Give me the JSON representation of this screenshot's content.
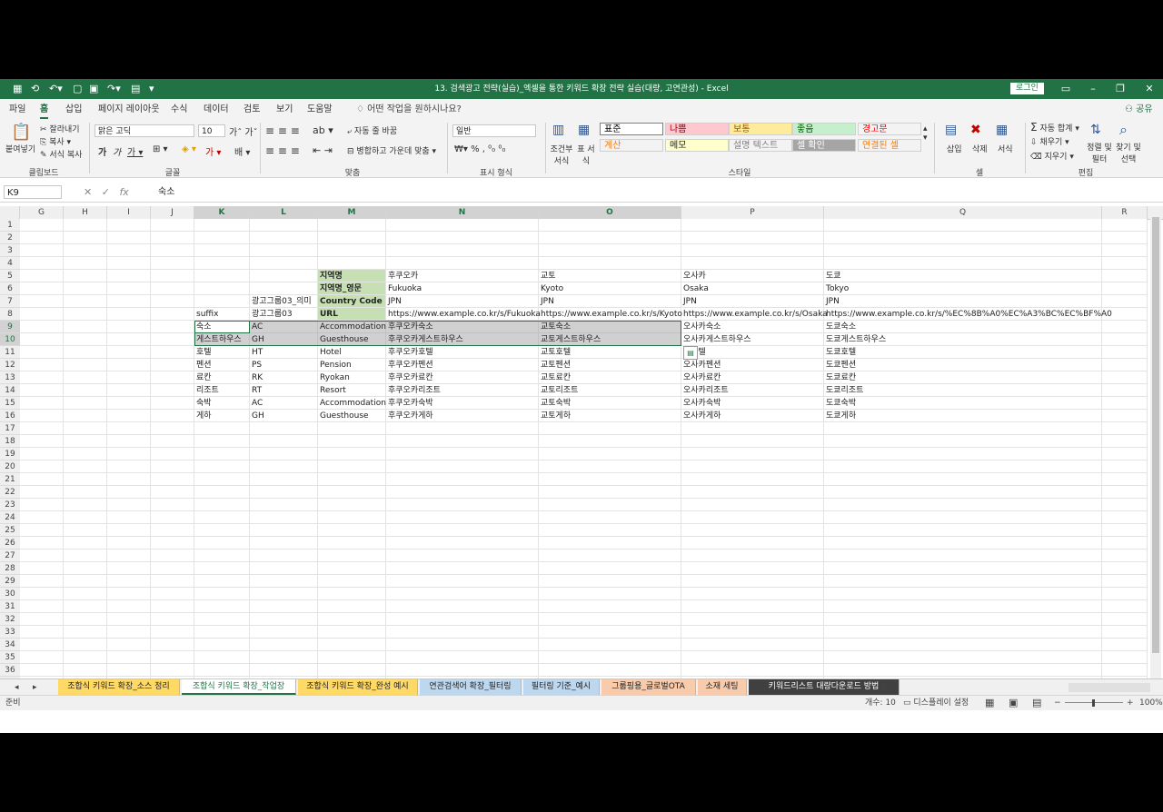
{
  "window": {
    "title": "13. 검색광고 전략(실습)_엑셀을 통한 키워드 확장 전략 실습(대량, 고연관성)  -  Excel",
    "login_label": "로그인"
  },
  "ribbon_tabs": [
    "파일",
    "홈",
    "삽입",
    "페이지 레이아웃",
    "수식",
    "데이터",
    "검토",
    "보기",
    "도움말"
  ],
  "active_tab": "홈",
  "tell_me": "어떤 작업을 원하시나요?",
  "share_label": "공유",
  "ribbon": {
    "clipboard": {
      "paste": "붙여넣기",
      "cut": "잘라내기",
      "copy": "복사",
      "format_painter": "서식 복사",
      "label": "클립보드"
    },
    "font": {
      "name": "맑은 고딕",
      "size": "10",
      "label": "글꼴"
    },
    "alignment": {
      "wrap": "자동 줄 바꿈",
      "merge": "병합하고 가운데 맞춤",
      "label": "맞춤"
    },
    "number": {
      "format": "일반",
      "label": "표시 형식"
    },
    "styles": {
      "conditional": "조건부 서식",
      "table": "표 서식",
      "items": [
        {
          "label": "표준",
          "bg": "#ffffff",
          "color": "#000000"
        },
        {
          "label": "나쁨",
          "bg": "#ffc7ce",
          "color": "#9c0006"
        },
        {
          "label": "보통",
          "bg": "#ffeb9c",
          "color": "#9c5700"
        },
        {
          "label": "좋음",
          "bg": "#c6efce",
          "color": "#006100"
        },
        {
          "label": "경고문",
          "bg": "#f3f3f3",
          "color": "#ff0000"
        },
        {
          "label": "계산",
          "bg": "#f2f2f2",
          "color": "#fa7d00"
        },
        {
          "label": "메모",
          "bg": "#ffffcc",
          "color": "#222222"
        },
        {
          "label": "설명 텍스트",
          "bg": "#f3f3f3",
          "color": "#7f7f7f"
        },
        {
          "label": "셀 확인",
          "bg": "#a5a5a5",
          "color": "#ffffff"
        },
        {
          "label": "연결된 셀",
          "bg": "#f3f3f3",
          "color": "#fa7d00"
        }
      ],
      "label": "스타일"
    },
    "cells": {
      "insert": "삽입",
      "delete": "삭제",
      "format": "서식",
      "label": "셀"
    },
    "editing": {
      "autosum": "자동 합계",
      "fill": "채우기",
      "clear": "지우기",
      "sort": "정렬 및 필터",
      "find": "찾기 및 선택",
      "label": "편집"
    }
  },
  "formula_bar": {
    "name_box": "K9",
    "formula": "숙소"
  },
  "columns": [
    "G",
    "H",
    "I",
    "J",
    "K",
    "L",
    "M",
    "N",
    "O",
    "P",
    "Q",
    "R"
  ],
  "rows": [
    "1",
    "2",
    "3",
    "4",
    "5",
    "6",
    "7",
    "8",
    "9",
    "10",
    "11",
    "12",
    "13",
    "14",
    "15",
    "16",
    "17",
    "18",
    "19",
    "20",
    "21",
    "22",
    "23",
    "24",
    "25",
    "26",
    "27",
    "28",
    "29",
    "30",
    "31",
    "32",
    "33",
    "34",
    "35",
    "36"
  ],
  "grid": {
    "r5": {
      "M": "지역명",
      "N": "후쿠오카",
      "O": "교토",
      "P": "오사카",
      "Q": "도쿄"
    },
    "r6": {
      "M": "지역명_영문",
      "N": "Fukuoka",
      "O": "Kyoto",
      "P": "Osaka",
      "Q": "Tokyo"
    },
    "r7": {
      "L": "광고그룹03_의미",
      "M": "Country Code",
      "N": "JPN",
      "O": "JPN",
      "P": "JPN",
      "Q": "JPN"
    },
    "r8": {
      "K": "suffix",
      "L": "광고그룹03",
      "M": "URL",
      "N": "https://www.example.co.kr/s/Fukuoka",
      "O": "https://www.example.co.kr/s/Kyoto",
      "P": "https://www.example.co.kr/s/Osaka",
      "Q": "https://www.example.co.kr/s/%EC%8B%A0%EC%A3%BC%EC%BF%A0"
    },
    "r9": {
      "K": "숙소",
      "L": "AC",
      "M": "Accommodation",
      "N": "후쿠오카숙소",
      "O": "교토숙소",
      "P": "오사카숙소",
      "Q": "도쿄숙소"
    },
    "r10": {
      "K": "게스트하우스",
      "L": "GH",
      "M": "Guesthouse",
      "N": "후쿠오카게스트하우스",
      "O": "교토게스트하우스",
      "P": "오사카게스트하우스",
      "Q": "도쿄게스트하우스"
    },
    "r11": {
      "K": "호텔",
      "L": "HT",
      "M": "Hotel",
      "N": "후쿠오카호텔",
      "O": "교토호텔",
      "P": "카호텔",
      "Q": "도쿄호텔"
    },
    "r12": {
      "K": "펜션",
      "L": "PS",
      "M": "Pension",
      "N": "후쿠오카펜션",
      "O": "교토펜션",
      "P": "오사카펜션",
      "Q": "도쿄펜션"
    },
    "r13": {
      "K": "료칸",
      "L": "RK",
      "M": "Ryokan",
      "N": "후쿠오카료칸",
      "O": "교토료칸",
      "P": "오사카료칸",
      "Q": "도쿄료칸"
    },
    "r14": {
      "K": "리조트",
      "L": "RT",
      "M": "Resort",
      "N": "후쿠오카리조트",
      "O": "교토리조트",
      "P": "오사카리조트",
      "Q": "도쿄리조트"
    },
    "r15": {
      "K": "숙박",
      "L": "AC",
      "M": "Accommodation",
      "N": "후쿠오카숙박",
      "O": "교토숙박",
      "P": "오사카숙박",
      "Q": "도쿄숙박"
    },
    "r16": {
      "K": "게하",
      "L": "GH",
      "M": "Guesthouse",
      "N": "후쿠오카게하",
      "O": "교토게하",
      "P": "오사카게하",
      "Q": "도쿄게하"
    }
  },
  "sheet_tabs": [
    {
      "label": "조합식 키워드 확장_소스 정리",
      "color": "#ffd966",
      "active": false
    },
    {
      "label": "조합식 키워드 확장_작업장",
      "color": "#ffffff",
      "active": true
    },
    {
      "label": "조합식 키워드 확장_완성 예시",
      "color": "#ffd966",
      "active": false
    },
    {
      "label": "연관검색어 확장_필터링",
      "color": "#bdd7ee",
      "active": false
    },
    {
      "label": "필터링 기준_예시",
      "color": "#bdd7ee",
      "active": false
    },
    {
      "label": "그룹핑용_글로벌OTA",
      "color": "#f8cbad",
      "active": false
    },
    {
      "label": "소재 세팅",
      "color": "#f8cbad",
      "active": false
    },
    {
      "label": "키워드리스트 대량다운로드 방법",
      "color": "#404040",
      "active": false
    }
  ],
  "status": {
    "ready": "준비",
    "count": "개수: 10",
    "display_settings": "디스플레이 설정",
    "zoom": "100%"
  }
}
